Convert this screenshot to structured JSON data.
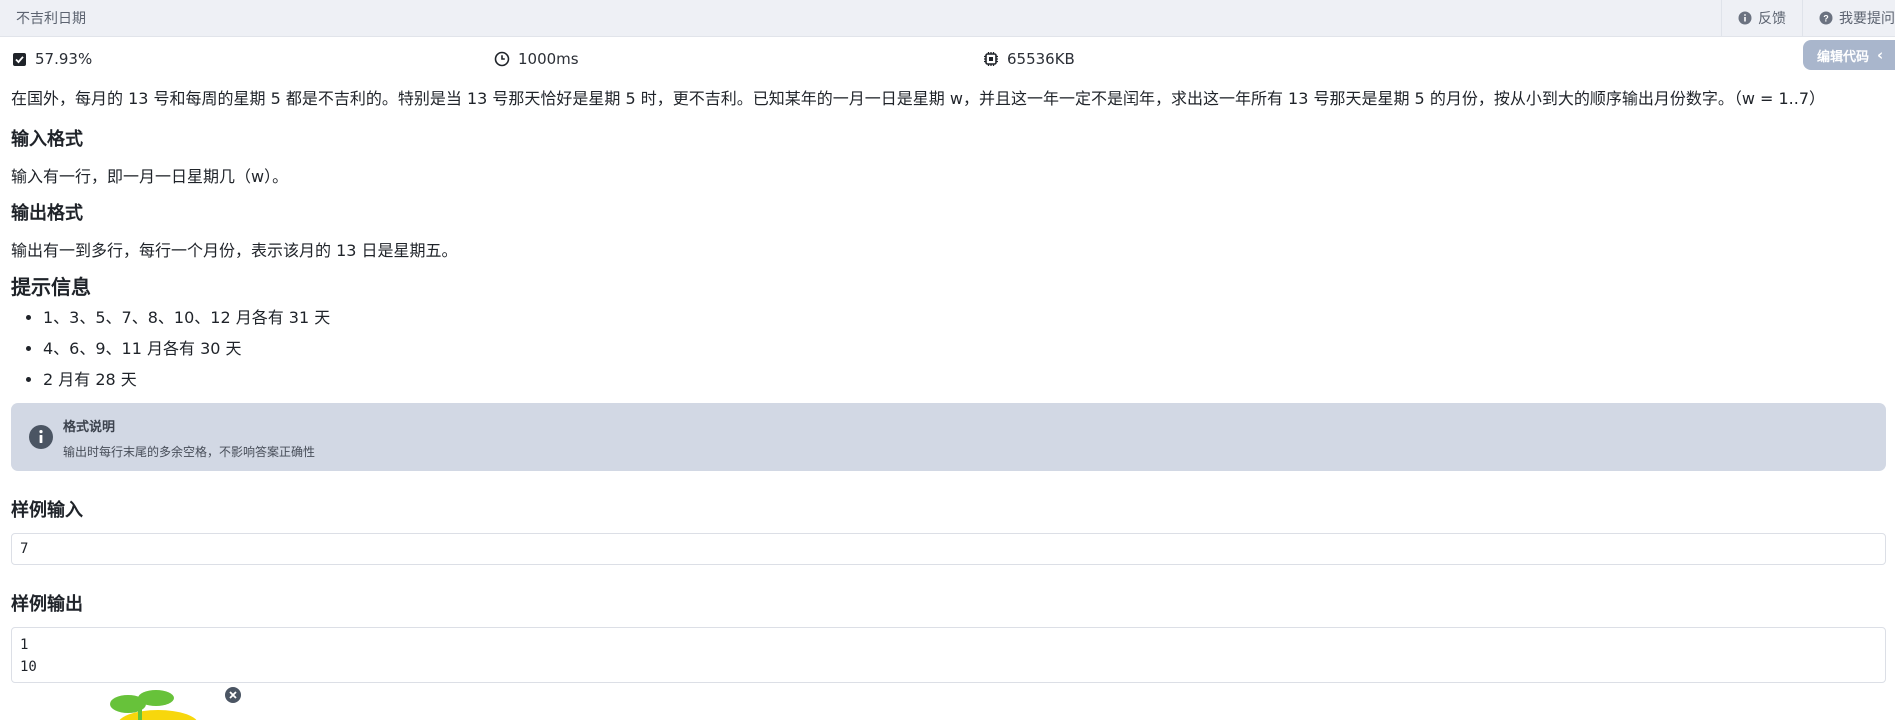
{
  "topbar": {
    "title": "不吉利日期",
    "feedback_label": "反馈",
    "ask_label": "我要提问"
  },
  "stats": {
    "pass_rate": "57.93%",
    "time_limit": "1000ms",
    "memory_limit": "65536KB"
  },
  "edit_code_label": "编辑代码",
  "problem": {
    "description": "在国外，每月的 13 号和每周的星期 5 都是不吉利的。特别是当 13 号那天恰好是星期 5 时，更不吉利。已知某年的一月一日是星期 w，并且这一年一定不是闰年，求出这一年所有 13 号那天是星期 5 的月份，按从小到大的顺序输出月份数字。（w = 1..7）",
    "input_title": "输入格式",
    "input_text": "输入有一行，即一月一日星期几（w）。",
    "output_title": "输出格式",
    "output_text": "输出有一到多行，每行一个月份，表示该月的 13 日是星期五。",
    "hint_title": "提示信息",
    "hints": [
      "1、3、5、7、8、10、12 月各有 31 天",
      "4、6、9、11 月各有 30 天",
      "2 月有 28 天"
    ]
  },
  "notice": {
    "title": "格式说明",
    "text": "输出时每行末尾的多余空格，不影响答案正确性"
  },
  "sample_input": {
    "title": "样例输入",
    "lines": [
      "7"
    ]
  },
  "sample_output": {
    "title": "样例输出",
    "lines": [
      "1",
      "10"
    ]
  },
  "colors": {
    "topbar_bg": "#eef0f5",
    "notice_bg": "#d2d8e4",
    "edit_button_bg": "#a9b6cc",
    "mascot_yellow": "#f7d70c",
    "mascot_green": "#67c23a"
  }
}
